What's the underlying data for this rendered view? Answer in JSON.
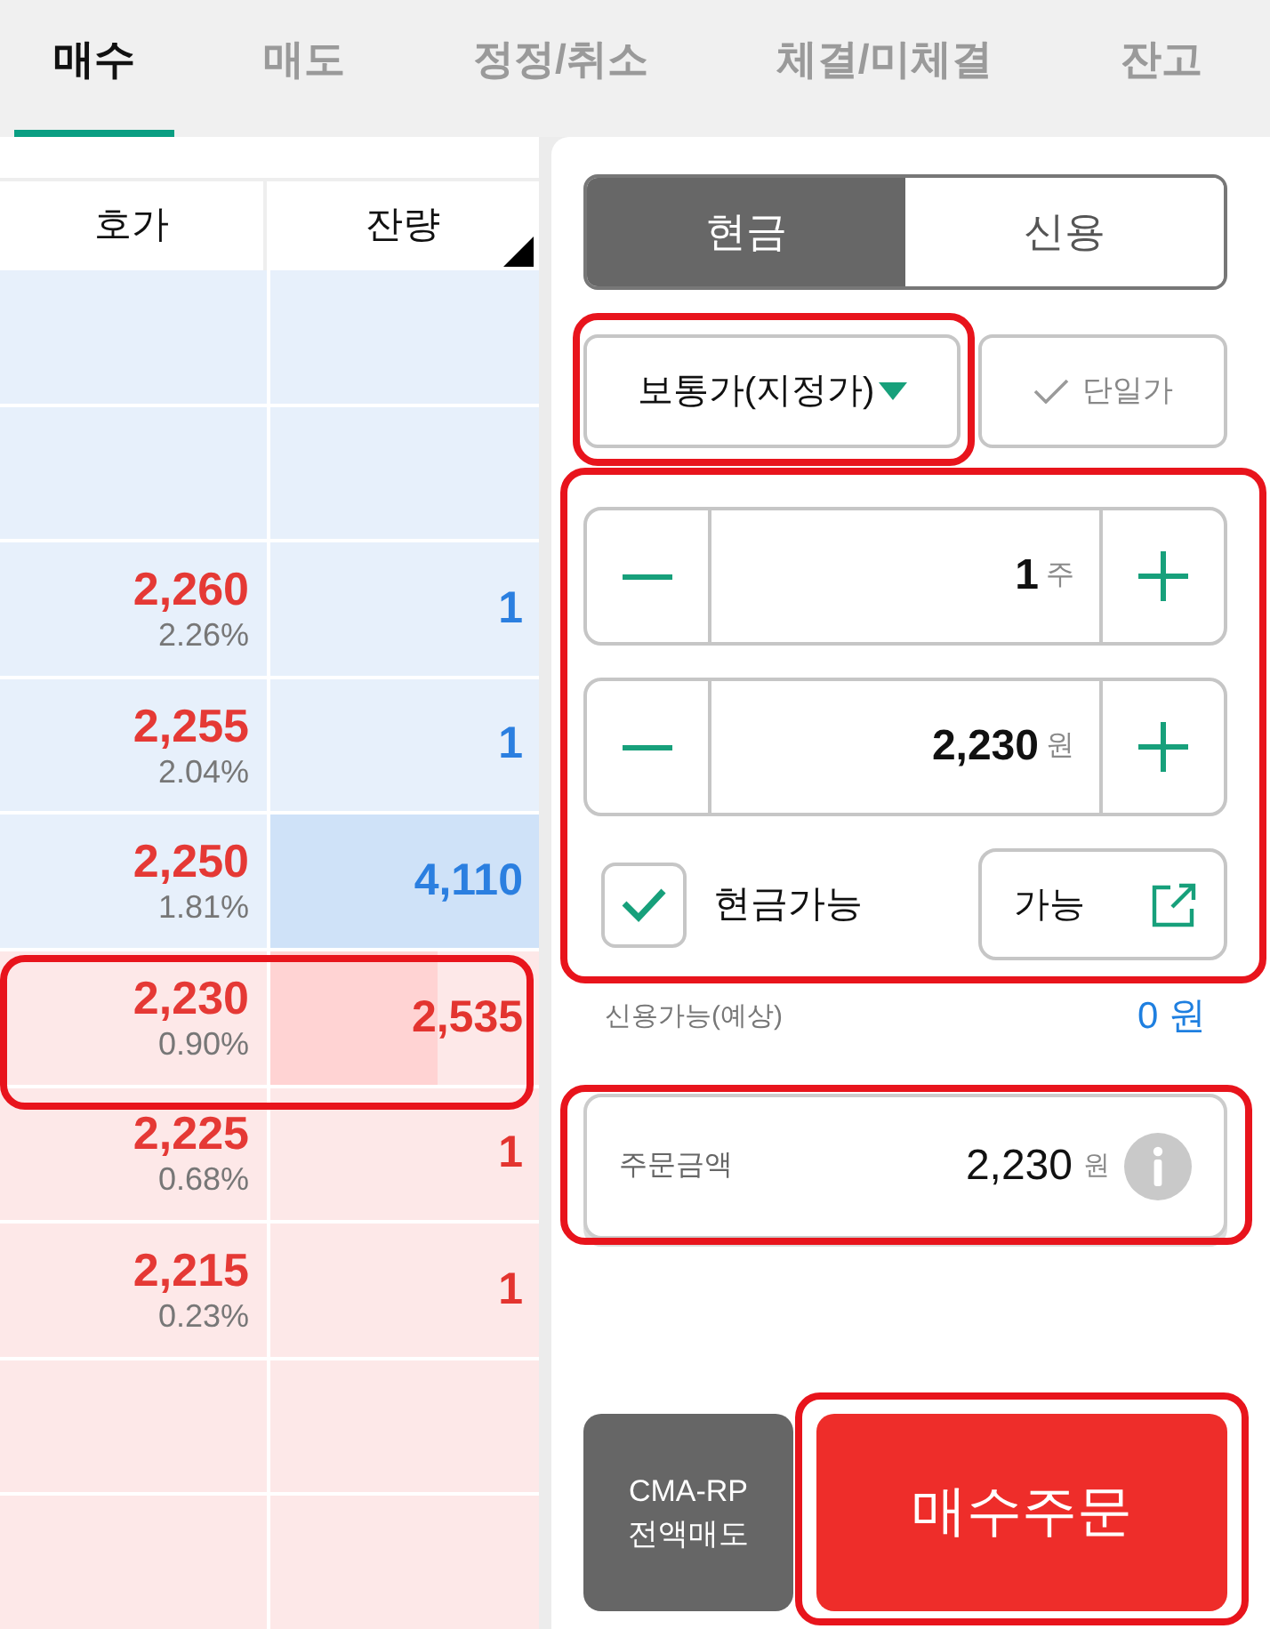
{
  "tabs": [
    {
      "label": "매수",
      "selected": true
    },
    {
      "label": "매도",
      "selected": false
    },
    {
      "label": "정정/취소",
      "selected": false
    },
    {
      "label": "체결/미체결",
      "selected": false
    },
    {
      "label": "잔고",
      "selected": false
    }
  ],
  "order_book": {
    "columns": [
      "호가",
      "잔량"
    ],
    "rows": [
      {
        "kind": "ask"
      },
      {
        "kind": "ask"
      },
      {
        "kind": "ask",
        "price": "2,260",
        "change": "2.26%",
        "quantity": "1"
      },
      {
        "kind": "ask",
        "price": "2,255",
        "change": "2.04%",
        "quantity": "1"
      },
      {
        "kind": "ask",
        "price": "2,250",
        "change": "1.81%",
        "quantity": "4,110",
        "level": 1
      },
      {
        "kind": "bid",
        "price": "2,230",
        "change": "0.90%",
        "quantity": "2,535",
        "level": 0.62,
        "highlighted": true
      },
      {
        "kind": "bid",
        "price": "2,225",
        "change": "0.68%",
        "quantity": "1"
      },
      {
        "kind": "bid",
        "price": "2,215",
        "change": "0.23%",
        "quantity": "1"
      },
      {
        "kind": "bid"
      },
      {
        "kind": "bid"
      }
    ]
  },
  "order_form": {
    "account_type": [
      {
        "label": "현금",
        "selected": true
      },
      {
        "label": "신용",
        "selected": false
      }
    ],
    "order_type": {
      "value": "보통가(지정가)",
      "highlighted": true
    },
    "single_price": {
      "label": "단일가",
      "checked": false
    },
    "inputs": {
      "highlighted": true,
      "quantity": {
        "value": "1",
        "unit": "주"
      },
      "price": {
        "value": "2,230",
        "unit": "원"
      },
      "cash_only": {
        "label": "현금가능",
        "checked": true
      },
      "available_button": {
        "label": "가능"
      }
    },
    "credit_available": {
      "label": "신용가능(예상)",
      "value": "0 원"
    },
    "order_amount": {
      "label": "주문금액",
      "value": "2,230",
      "unit": "원",
      "highlighted": true
    },
    "buttons": [
      {
        "kind": "secondary",
        "lines": [
          "CMA-RP",
          "전액매도"
        ]
      },
      {
        "kind": "primary",
        "lines": [
          "매수주문"
        ],
        "highlighted": true
      }
    ]
  }
}
